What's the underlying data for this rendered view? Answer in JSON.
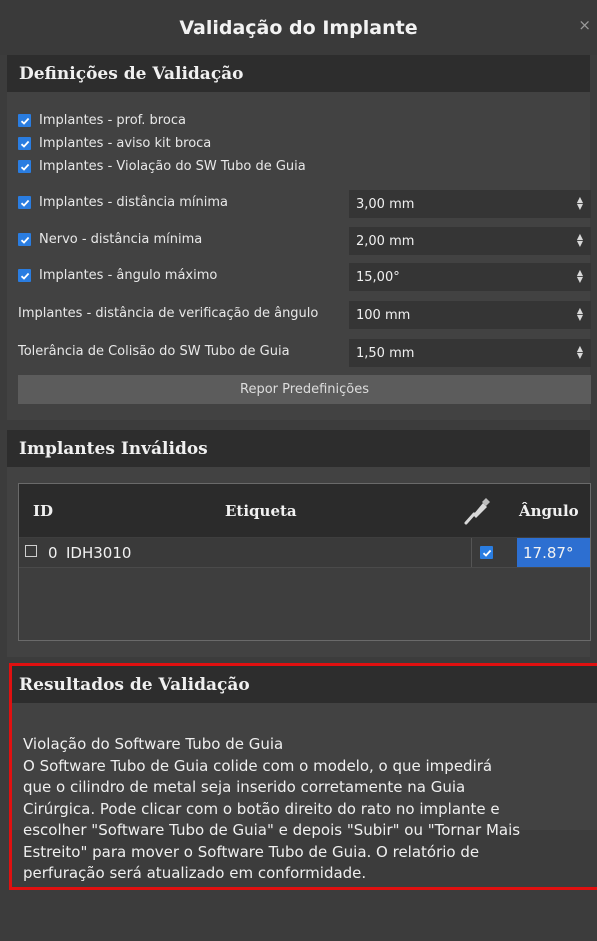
{
  "window": {
    "title": "Validação do Implante",
    "close_glyph": "×"
  },
  "settings": {
    "header": "Definições de Validação",
    "checkboxes": [
      {
        "label": "Implantes - prof. broca",
        "checked": true
      },
      {
        "label": "Implantes - aviso kit broca",
        "checked": true
      },
      {
        "label": "Implantes - Violação do SW Tubo de Guia",
        "checked": true
      }
    ],
    "fields": [
      {
        "label": "Implantes - distância mínima",
        "checked": true,
        "value": "3,00 mm"
      },
      {
        "label": "Nervo - distância mínima",
        "checked": true,
        "value": "2,00 mm"
      },
      {
        "label": "Implantes - ângulo máximo",
        "checked": true,
        "value": "15,00°"
      },
      {
        "label": "Implantes - distância de verificação de ângulo",
        "value": "100 mm"
      },
      {
        "label": "Tolerância de Colisão do SW Tubo de Guia",
        "value": "1,50 mm"
      }
    ],
    "reset_label": "Repor Predefinições"
  },
  "invalid": {
    "header": "Implantes Inválidos",
    "columns": {
      "id": "ID",
      "label": "Etiqueta",
      "tool_icon": "drill-icon",
      "angle": "Ângulo"
    },
    "rows": [
      {
        "id": "0",
        "label": "IDH3010",
        "angle": "17.87°",
        "selected": true
      }
    ]
  },
  "results": {
    "header": "Resultados de Validação",
    "lines": [
      "Violação do Software Tubo de Guia",
      "O Software Tubo de Guia colide com o modelo, o que impedirá",
      "que o cilindro de metal seja inserido corretamente na Guia",
      "Cirúrgica. Pode clicar com o botão direito do rato no implante e",
      "escolher \"Software Tubo de Guia\" e depois \"Subir\" ou \"Tornar Mais",
      "Estreito\" para mover o Software Tubo de Guia. O relatório de",
      "perfuração será atualizado em conformidade."
    ]
  },
  "colors": {
    "accent": "#2a7de1",
    "selection": "#2d6fd1",
    "highlight": "#e01010"
  }
}
